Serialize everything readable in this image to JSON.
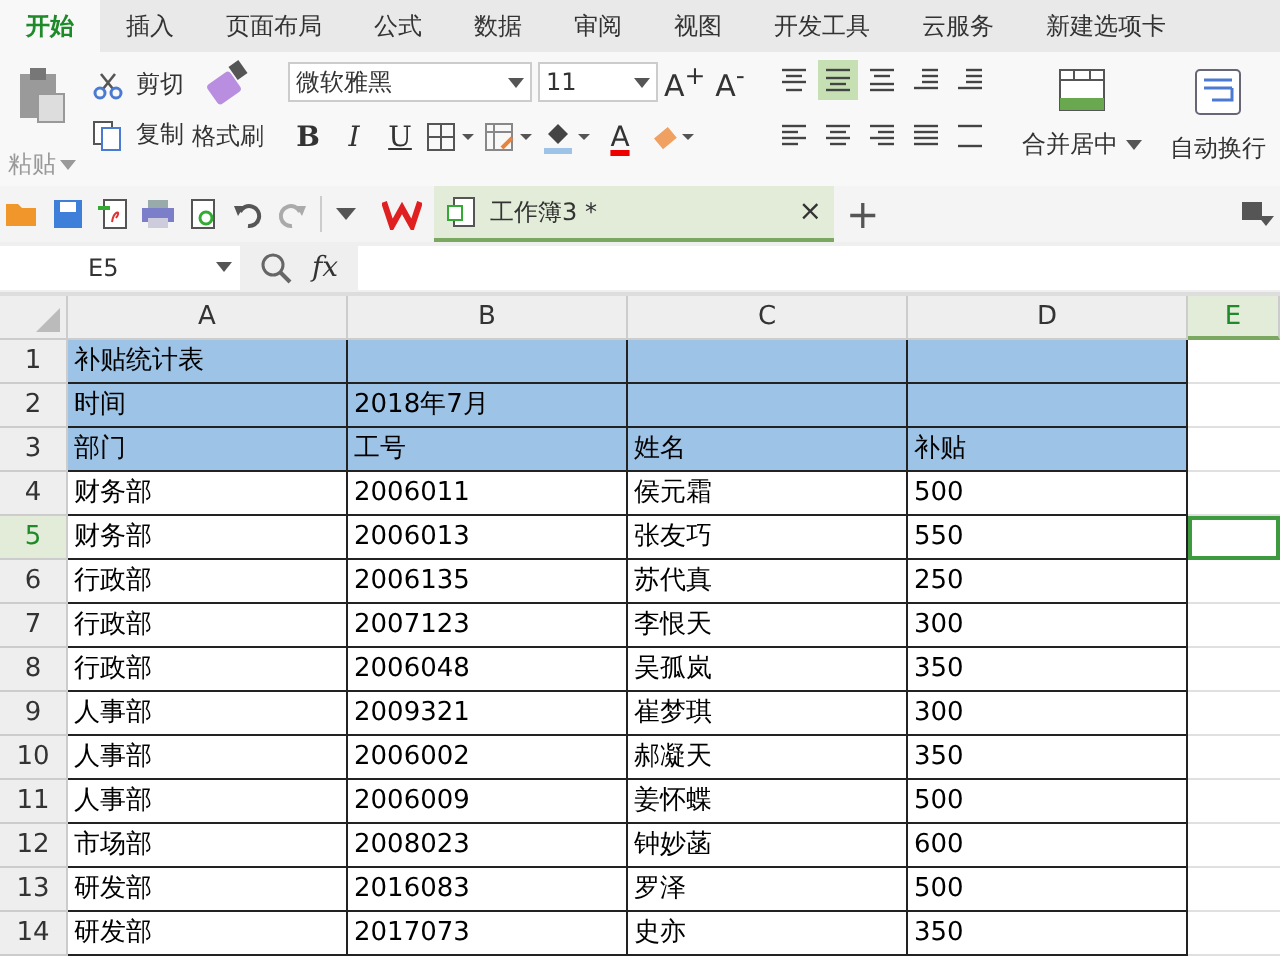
{
  "tabs": [
    {
      "label": "开始",
      "selected": true
    },
    {
      "label": "插入",
      "selected": false
    },
    {
      "label": "页面布局",
      "selected": false
    },
    {
      "label": "公式",
      "selected": false
    },
    {
      "label": "数据",
      "selected": false
    },
    {
      "label": "审阅",
      "selected": false
    },
    {
      "label": "视图",
      "selected": false
    },
    {
      "label": "开发工具",
      "selected": false
    },
    {
      "label": "云服务",
      "selected": false
    },
    {
      "label": "新建选项卡",
      "selected": false
    }
  ],
  "ribbon": {
    "paste": "粘贴",
    "cut": "剪切",
    "copy": "复制",
    "format_painter": "格式刷",
    "font_name": "微软雅黑",
    "font_size": "11",
    "grow_font": "A$^{+}$",
    "shrink_font": "A$^{-}$",
    "bold": "B",
    "italic": "I",
    "underline": "U",
    "font_color": "A",
    "align_buttons": [
      {
        "kind": "top",
        "selected": false
      },
      {
        "kind": "middle",
        "selected": true
      },
      {
        "kind": "bottom",
        "selected": false
      },
      {
        "kind": "outdent",
        "selected": false
      },
      {
        "kind": "indent",
        "selected": false
      },
      {
        "kind": "left",
        "selected": false
      },
      {
        "kind": "center",
        "selected": false
      },
      {
        "kind": "right",
        "selected": false
      },
      {
        "kind": "justify",
        "selected": false
      },
      {
        "kind": "distributed",
        "selected": false
      }
    ],
    "merge": "合并居中",
    "wrap": "自动换行"
  },
  "doc_tab": {
    "title": "工作簿3 *",
    "close": "×",
    "new": "+"
  },
  "formula_bar": {
    "name_box": "E5",
    "fx": "fx"
  },
  "sheet": {
    "columns": [
      {
        "label": "A",
        "selected": false
      },
      {
        "label": "B",
        "selected": false
      },
      {
        "label": "C",
        "selected": false
      },
      {
        "label": "D",
        "selected": false
      },
      {
        "label": "E",
        "selected": true
      }
    ],
    "rows": [
      {
        "num": "1",
        "filled": true,
        "selected": false,
        "cells": [
          "补贴统计表",
          "",
          "",
          ""
        ]
      },
      {
        "num": "2",
        "filled": true,
        "selected": false,
        "cells": [
          "时间",
          "2018年7月",
          "",
          ""
        ]
      },
      {
        "num": "3",
        "filled": true,
        "selected": false,
        "cells": [
          "部门",
          "工号",
          "姓名",
          "补贴"
        ]
      },
      {
        "num": "4",
        "filled": false,
        "selected": false,
        "cells": [
          "财务部",
          "2006011",
          "侯元霜",
          "500"
        ]
      },
      {
        "num": "5",
        "filled": false,
        "selected": true,
        "cells": [
          "财务部",
          "2006013",
          "张友巧",
          "550"
        ]
      },
      {
        "num": "6",
        "filled": false,
        "selected": false,
        "cells": [
          "行政部",
          "2006135",
          "苏代真",
          "250"
        ]
      },
      {
        "num": "7",
        "filled": false,
        "selected": false,
        "cells": [
          "行政部",
          "2007123",
          "李恨天",
          "300"
        ]
      },
      {
        "num": "8",
        "filled": false,
        "selected": false,
        "cells": [
          "行政部",
          "2006048",
          "吴孤岚",
          "350"
        ]
      },
      {
        "num": "9",
        "filled": false,
        "selected": false,
        "cells": [
          "人事部",
          "2009321",
          "崔梦琪",
          "300"
        ]
      },
      {
        "num": "10",
        "filled": false,
        "selected": false,
        "cells": [
          "人事部",
          "2006002",
          "郝凝天",
          "350"
        ]
      },
      {
        "num": "11",
        "filled": false,
        "selected": false,
        "cells": [
          "人事部",
          "2006009",
          "姜怀蝶",
          "500"
        ]
      },
      {
        "num": "12",
        "filled": false,
        "selected": false,
        "cells": [
          "市场部",
          "2008023",
          "钟妙菡",
          "600"
        ]
      },
      {
        "num": "13",
        "filled": false,
        "selected": false,
        "cells": [
          "研发部",
          "2016083",
          "罗泽",
          "500"
        ]
      },
      {
        "num": "14",
        "filled": false,
        "selected": false,
        "cells": [
          "研发部",
          "2017073",
          "史亦",
          "350"
        ]
      }
    ]
  }
}
